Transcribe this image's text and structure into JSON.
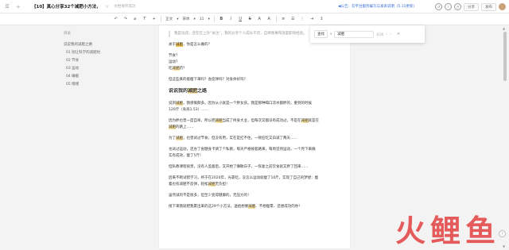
{
  "topbar": {
    "menu_icon": "menu-icon",
    "doc_title": "【10】真心分享32个减肥小方法，",
    "save_status": "文档保存成功",
    "notice": "◀公告：云平台服务编写与发表说明（5.15更新）",
    "history_label": "历史",
    "share_label": "分享",
    "more_label": "发布"
  },
  "toolbar": {
    "font_family": "正文",
    "font_name": "宋体",
    "font_size": "11",
    "bold": "B",
    "italic": "I",
    "underline": "U",
    "strike": "S",
    "font_color": "A",
    "text_a": "A"
  },
  "sidebar": {
    "title": "目录",
    "items": [
      {
        "label": "说说我的减肥之路"
      },
      {
        "label": "01 别让科学的减肥坑"
      },
      {
        "label": "02 节食"
      },
      {
        "label": "03 运动"
      },
      {
        "label": "04 睡眠"
      },
      {
        "label": "05 情绪"
      }
    ]
  },
  "findbox": {
    "mode": "查找",
    "query": "减肥",
    "count": "4/30"
  },
  "content": {
    "quote": "我是逗叔。还在在上升“关注”，我的分享个人成长干货，自律情事和温度职场经验。",
    "para1_pre": "关于",
    "para1_hl": "减肥",
    "para1_post": "，你是怎么做的？",
    "list": [
      {
        "pre": "节食？",
        "hl": "",
        "post": ""
      },
      {
        "pre": "运动？",
        "hl": "",
        "post": ""
      },
      {
        "pre": "吃",
        "hl": "减肥",
        "post": "药？"
      }
    ],
    "para2": "但这些真的能瘦下来吗？会反弹吗？对身体好吗？",
    "heading_pre": "说说我的",
    "heading_hl": "减肥",
    "heading_post": "之路",
    "p3_a": "说到",
    "p3_hl1": "减肥",
    "p3_b": "，我感慨颇多。因为从小就是一个胖女孩。我是那种喝口凉水都胖的，重到的时候",
    "p3_c": "120斤（身高1.53）……",
    "p4_a": "因为胖也曾一度自卑。所以把",
    "p4_hl1": "减肥",
    "p4_b": "当成了终身大业，但每次又都没有成功过，不是在",
    "p4_hl2": "减肥",
    "p4_c": "就是在",
    "p4_hl3": "减肥",
    "p4_d": "的路上……",
    "p5_a": "为了",
    "p5_hl1": "减肥",
    "p5_b": "，也曾试过节食，但没有用，实在是扛不住，一顿狂吃又白减了两天……",
    "p6_a": "也试过运动，还办了张健身卡请了个私教，每天严格按套路来，每周坚持运动，一个月下来确",
    "p6_b": "实有成效，瘦了5斤！",
    "p7": "但私教课程很贵，没有人监督后，又开始了懒散日子，一恢复之前饮食就又胖了回来……",
    "p8_a": "后来不断试错学习，终于在2020年，光靠吃，没怎么运动就瘦了10斤，实现了自己的梦想：瘦",
    "p8_b": "着也有",
    "p8_c": "减肥",
    "p8_d": "不反弹，轻松",
    "p8_hl": "减肥",
    "p8_e": "无负担！",
    "p9": "虽然减的不是很多，但至少变得健康的，无压力的！",
    "p10_a": "接下来我就把我累出来的这29个小方法，送给想要",
    "p10_hl": "减肥",
    "p10_b": "、不想瘦累、还想成功的你！"
  },
  "watermark": {
    "chars": [
      "火",
      "鲤",
      "鱼"
    ]
  },
  "colors": {
    "highlight": "#fbe3a2",
    "highlight_current": "#f4c653",
    "watermark_red": "#e44a4a",
    "link_blue": "#3a6ed8"
  }
}
